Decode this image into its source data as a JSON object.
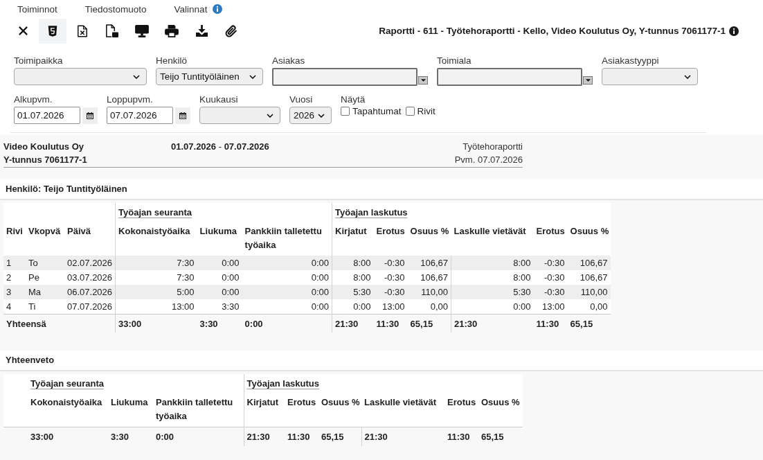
{
  "menu": [
    "Toiminnot",
    "Tiedostomuoto",
    "Valinnat"
  ],
  "toolbar": [
    {
      "kind": "close",
      "selected": false
    },
    {
      "kind": "html",
      "selected": true
    },
    {
      "kind": "excel",
      "selected": false
    },
    {
      "kind": "pdf",
      "selected": false
    },
    {
      "kind": "screen",
      "selected": false
    },
    {
      "kind": "print",
      "selected": false
    },
    {
      "kind": "download",
      "selected": false
    },
    {
      "kind": "attach",
      "selected": false
    }
  ],
  "report_title": "Raportti - 611 - Työtehoraportti - Kello, Video Koulutus Oy, Y-tunnus 7061177-1",
  "filters": [
    {
      "fields": [
        {
          "kind": "select",
          "label": "Toimipaikka"
        },
        {
          "kind": "select",
          "label": "Henkilö",
          "value": "Teijo Tuntityöläinen"
        },
        {
          "kind": "combo",
          "label": "Asiakas"
        },
        {
          "kind": "combo",
          "label": "Toimiala"
        },
        {
          "kind": "select",
          "label": "Asiakastyyppi"
        }
      ]
    },
    {
      "fields": [
        {
          "kind": "date",
          "label": "Alkupvm.",
          "value": "01.07.2026"
        },
        {
          "kind": "date",
          "label": "Loppupvm.",
          "value": "07.07.2026"
        },
        {
          "kind": "select",
          "label": "Kuukausi"
        },
        {
          "kind": "select",
          "label": "Vuosi",
          "value": "2026"
        },
        {
          "kind": "checks",
          "label": "Näytä",
          "options": [
            {
              "label": "Tapahtumat",
              "checked": false
            },
            {
              "label": "Rivit",
              "checked": false
            }
          ]
        }
      ]
    }
  ],
  "report_header": {
    "company": "Video Koulutus Oy",
    "business_id": "Y-tunnus 7061177-1",
    "date_range": "**01.07.2026** - **07.07.2026**",
    "report_name": "Työtehoraportti",
    "print_date": "Pvm. 07.07.2026"
  },
  "person_section": {
    "title": "Henkilö: Teijo Tuntityöläinen",
    "table": {
      "column_groups": [
        {
          "columns": [
            "Rivi",
            "Vkopvä",
            "Päivä"
          ]
        },
        {
          "title": "Työajan seuranta",
          "columns": [
            "Kokonaistyöaika",
            "Liukuma",
            "Pankkiin talletettu työaika"
          ]
        },
        {
          "title": "Työajan laskutus",
          "columns": [
            "Kirjatut",
            "Erotus",
            "Osuus %",
            "Laskulle vietävät",
            "Erotus",
            "Osuus %"
          ]
        }
      ],
      "rows": [
        {
          "cells": [
            "1",
            "To",
            "02.07.2026",
            "7:30",
            "0:00",
            "0:00",
            "8:00",
            "-0:30",
            "106,67",
            "8:00",
            "-0:30",
            "106,67"
          ]
        },
        {
          "cells": [
            "2",
            "Pe",
            "03.07.2026",
            "7:30",
            "0:00",
            "0:00",
            "8:00",
            "-0:30",
            "106,67",
            "8:00",
            "-0:30",
            "106,67"
          ]
        },
        {
          "cells": [
            "3",
            "Ma",
            "06.07.2026",
            "5:00",
            "0:00",
            "0:00",
            "5:30",
            "-0:30",
            "110,00",
            "5:30",
            "-0:30",
            "110,00"
          ]
        },
        {
          "cells": [
            "4",
            "Ti",
            "07.07.2026",
            "13:00",
            "3:30",
            "0:00",
            "0:00",
            "13:00",
            "0,00",
            "0:00",
            "13:00",
            "0,00"
          ]
        }
      ],
      "total": {
        "label": "Yhteensä",
        "cells": [
          "33:00",
          "3:30",
          "0:00",
          "21:30",
          "11:30",
          "65,15",
          "21:30",
          "11:30",
          "65,15"
        ]
      }
    }
  },
  "summary_section": {
    "title": "Yhteenveto",
    "table": {
      "column_groups": [
        {
          "title": "Työajan seuranta",
          "columns": [
            "Kokonaistyöaika",
            "Liukuma",
            "Pankkiin talletettu työaika"
          ]
        },
        {
          "title": "Työajan laskutus",
          "columns": [
            "Kirjatut",
            "Erotus",
            "Osuus %",
            "Laskulle vietävät",
            "Erotus",
            "Osuus %"
          ]
        }
      ],
      "rows": [
        {
          "cells": [
            "33:00",
            "3:30",
            "0:00",
            "21:30",
            "11:30",
            "65,15",
            "21:30",
            "11:30",
            "65,15"
          ]
        }
      ]
    }
  }
}
